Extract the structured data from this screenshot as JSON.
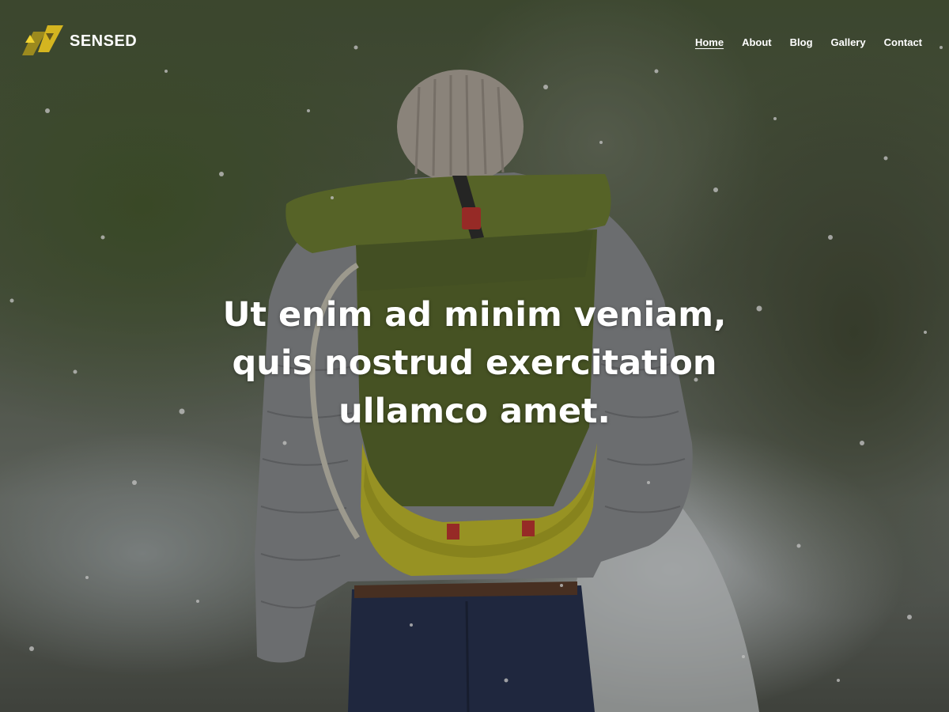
{
  "brand": {
    "name": "SENSED",
    "accent_color": "#d4b520",
    "logo_icon": "chevron-mark-icon"
  },
  "nav": {
    "items": [
      {
        "label": "Home",
        "active": true
      },
      {
        "label": "About",
        "active": false
      },
      {
        "label": "Blog",
        "active": false
      },
      {
        "label": "Gallery",
        "active": false
      },
      {
        "label": "Contact",
        "active": false
      }
    ]
  },
  "hero": {
    "headline_lines": [
      "Ut enim ad minim veniam,",
      "quis nostrud exercitation",
      "ullamco amet."
    ],
    "background": "winter-hiker-photo"
  }
}
